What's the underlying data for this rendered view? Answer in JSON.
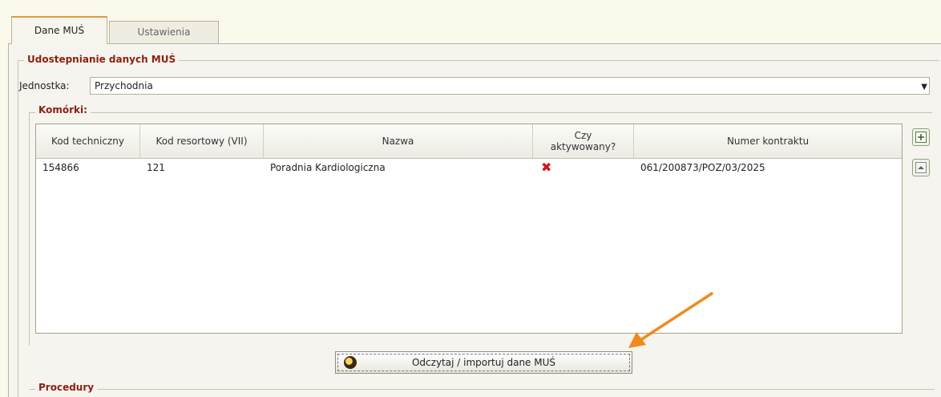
{
  "tabs": [
    {
      "label": "Dane MUŚ",
      "active": true
    },
    {
      "label": "Ustawienia",
      "active": false
    }
  ],
  "section_main": {
    "legend": "Udostepnianie danych MUŚ"
  },
  "unit": {
    "label": "Jednostka:",
    "value": "Przychodnia"
  },
  "cells_section": {
    "legend": "Komórki:"
  },
  "grid": {
    "columns": [
      "Kod techniczny",
      "Kod resortowy (VII)",
      "Nazwa",
      "Czy aktywowany?",
      "Numer kontraktu"
    ],
    "rows": [
      {
        "kod_techniczny": "154866",
        "kod_resortowy": "121",
        "nazwa": "Poradnia Kardiologiczna",
        "aktywowany_symbol": "✖",
        "numer_kontraktu": "061/200873/POZ/03/2025"
      }
    ]
  },
  "import_button": {
    "label": "Odczytaj / importuj dane MUŚ"
  },
  "procedures_section": {
    "legend": "Procedury"
  },
  "colors": {
    "legend": "#8c1f12",
    "accent": "#e49a3c",
    "arrow": "#f08a1c",
    "inactive_mark": "#d4141b"
  }
}
